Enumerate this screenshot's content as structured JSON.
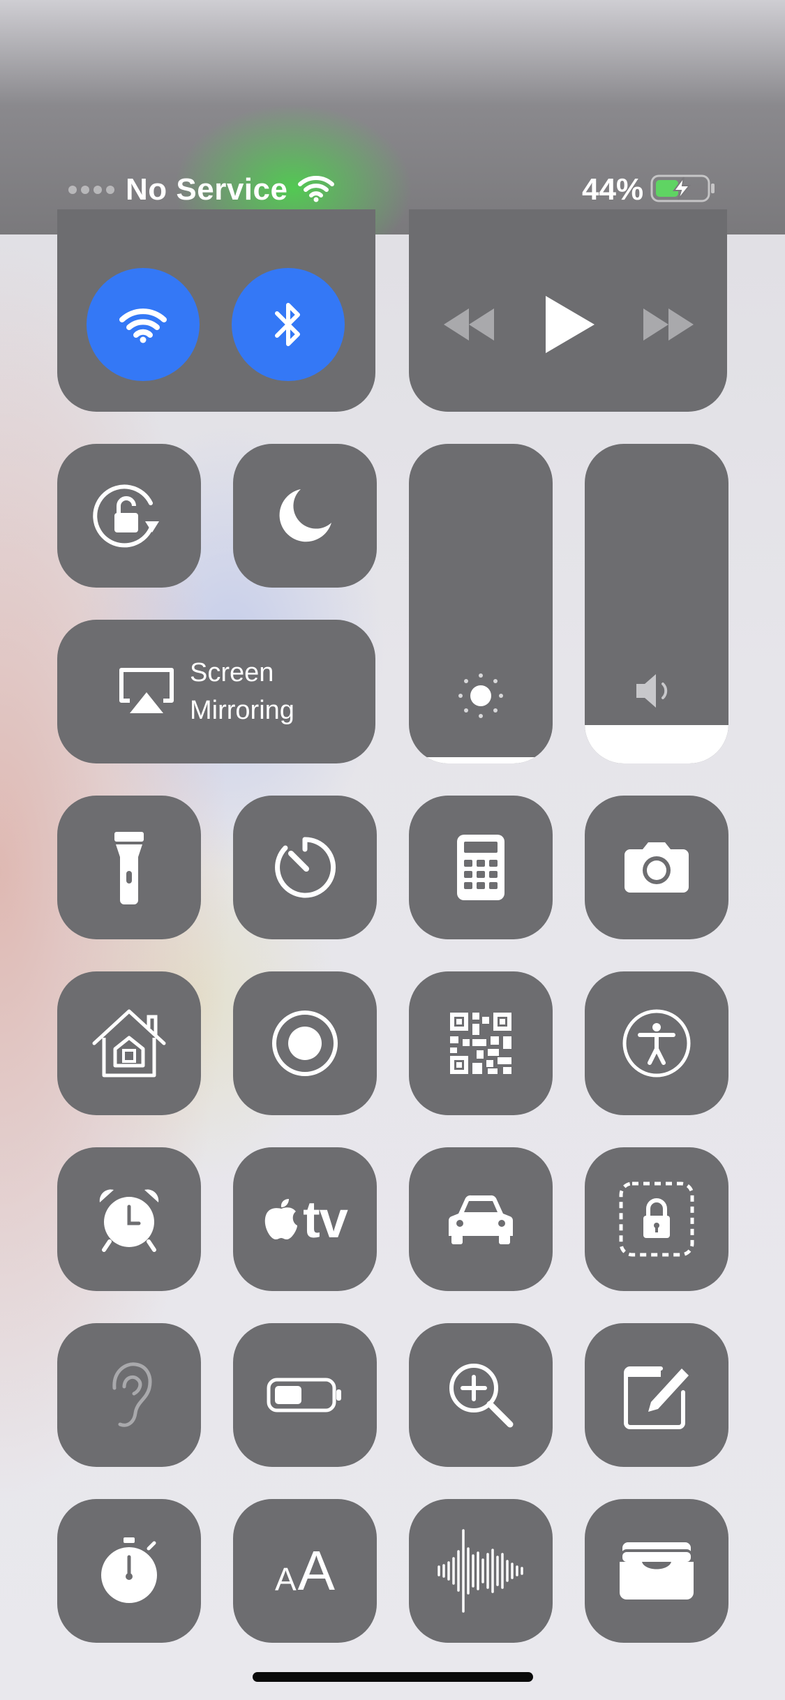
{
  "status_bar": {
    "carrier": "No Service",
    "battery_percent": "44%",
    "battery_level": 0.44,
    "charging": true
  },
  "connectivity": {
    "wifi": {
      "on": true,
      "icon": "wifi-icon"
    },
    "bluetooth": {
      "on": true,
      "icon": "bluetooth-icon"
    },
    "accent_color": "#3478f6"
  },
  "media": {
    "rewind_icon": "rewind-icon",
    "play_icon": "play-icon",
    "forward_icon": "fast-forward-icon"
  },
  "screen_mirroring": {
    "label_line1": "Screen",
    "label_line2": "Mirroring",
    "icon": "airplay-icon"
  },
  "sliders": {
    "brightness_level": 0.02,
    "volume_level": 0.12
  },
  "apple_tv_label": "tv",
  "text_size_label_small": "A",
  "text_size_label_large": "A",
  "controls": [
    "orientation-lock",
    "do-not-disturb",
    "flashlight",
    "timer",
    "calculator",
    "camera",
    "home",
    "screen-recording",
    "qr-code-scanner",
    "accessibility",
    "alarm",
    "apple-tv-remote",
    "driving-focus",
    "guided-access",
    "hearing",
    "low-power-mode",
    "magnifier",
    "notes",
    "stopwatch",
    "text-size",
    "voice-memos",
    "wallet"
  ]
}
